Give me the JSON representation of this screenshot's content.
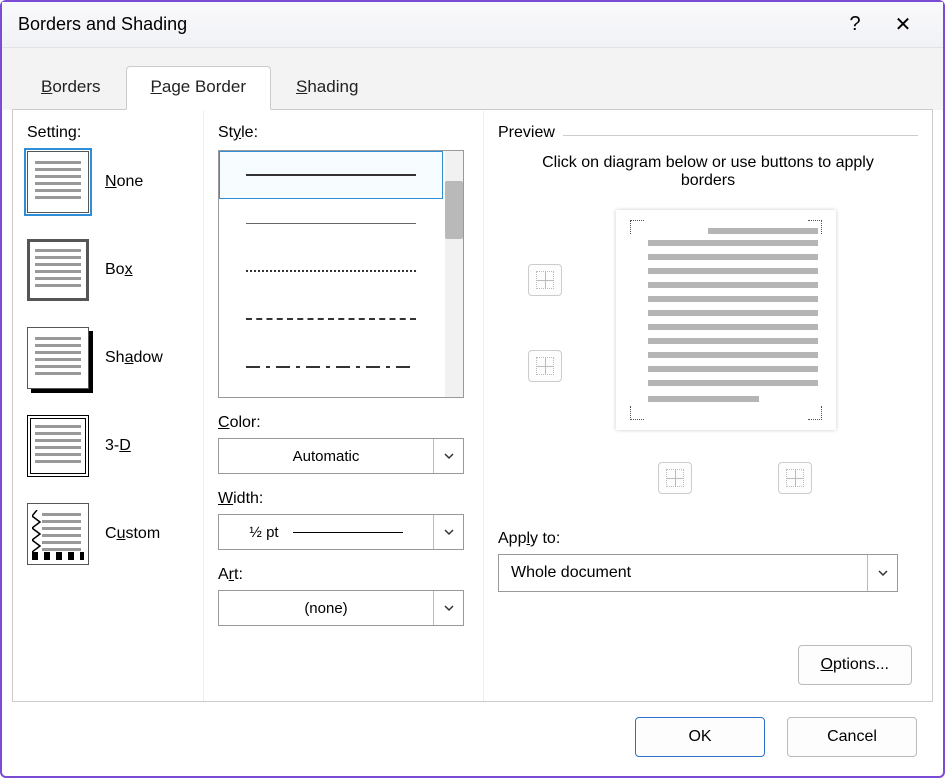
{
  "title": "Borders and Shading",
  "tabs": {
    "borders_pre": "B",
    "borders_post": "orders",
    "page_pre": "P",
    "page_post": "age Border",
    "shading_pre": "S",
    "shading_post": "hading"
  },
  "setting": {
    "label": "Setting:",
    "none_pre": "N",
    "none_post": "one",
    "box_pre": "Bo",
    "box_post": "x",
    "shadow_pre": "Sh",
    "shadow_u": "a",
    "shadow_post": "dow",
    "threed_pre": "3-",
    "threed_u": "D",
    "threed_post": "",
    "custom_pre": "C",
    "custom_u": "u",
    "custom_post": "stom"
  },
  "style": {
    "label_pre": "St",
    "label_u": "y",
    "label_post": "le:",
    "color_pre": "C",
    "color_post": "olor:",
    "color_value": "Automatic",
    "width_pre": "W",
    "width_post": "idth:",
    "width_value": "½ pt",
    "art_pre": "A",
    "art_u": "r",
    "art_post": "t:",
    "art_value": "(none)"
  },
  "preview": {
    "label": "Preview",
    "message": "Click on diagram below or use buttons to apply borders",
    "apply_pre": "App",
    "apply_u": "l",
    "apply_post": "y to:",
    "apply_value": "Whole document",
    "options_pre": "O",
    "options_post": "ptions..."
  },
  "footer": {
    "ok": "OK",
    "cancel": "Cancel"
  }
}
